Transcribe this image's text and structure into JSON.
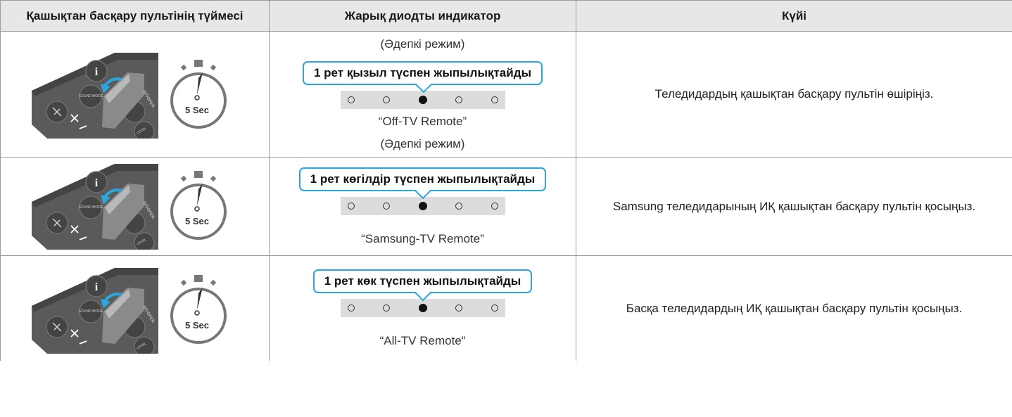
{
  "header": {
    "col1": "Қашықтан басқару пультінің түймесі",
    "col2": "Жарық диодты индикатор",
    "col3": "Күйі"
  },
  "remote_labels": {
    "sound_mode": "SOUND MODE",
    "woofer": "WOOFER",
    "level": "LEVEL",
    "info": "i"
  },
  "timer_label": "5 Sec",
  "rows": [
    {
      "led_above": "(Әдепкі режим)",
      "bubble": "1 рет қызыл түспен жыпылықтайды",
      "led_below": "“Off-TV Remote”",
      "led_below2": "(Әдепкі режим)",
      "status": "Теледидардың қашықтан басқару пультін өшіріңіз.",
      "leds": [
        0,
        0,
        1,
        0,
        0
      ]
    },
    {
      "bubble": "1 рет көгілдір түспен жыпылықтайды",
      "led_below": "“Samsung-TV Remote”",
      "status": "Samsung теледидарының ИҚ қашықтан басқару пультін қосыңыз.",
      "leds": [
        0,
        0,
        1,
        0,
        0
      ]
    },
    {
      "bubble": "1 рет көк түспен жыпылықтайды",
      "led_below": "“All-TV Remote”",
      "status": "Басқа теледидардың ИҚ қашықтан басқару пультін қосыңыз.",
      "leds": [
        0,
        0,
        1,
        0,
        0
      ]
    }
  ]
}
